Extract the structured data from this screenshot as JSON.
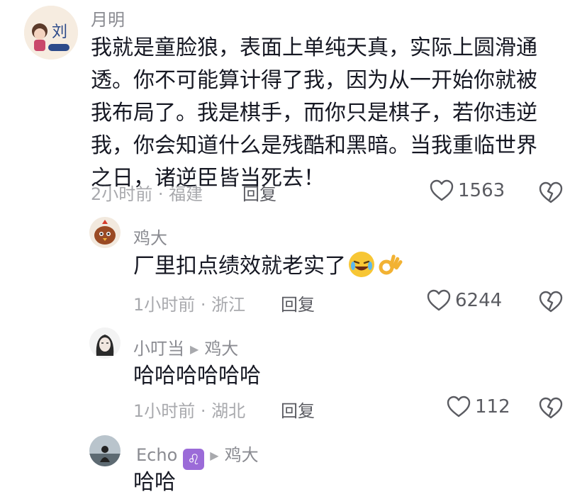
{
  "comments": [
    {
      "name": "月明",
      "text": "我就是童脸狼，表面上单纯天真，实际上圆滑通透。你不可能算计得了我，因为从一开始你就被我布局了。我是棋手，而你只是棋子，若你违逆我，你会知道什么是残酷和黑暗。当我重临世界之日，诸逆臣皆当死去！",
      "meta": "2小时前 · 福建",
      "reply_label": "回复",
      "likes": "1563"
    },
    {
      "name": "鸡大",
      "text": "厂里扣点绩效就老实了",
      "emojis": [
        "laughing-crying-emoji",
        "ok-hand-emoji"
      ],
      "meta": "1小时前 · 浙江",
      "reply_label": "回复",
      "likes": "6244"
    },
    {
      "name": "小叮当",
      "reply_to": "鸡大",
      "text": "哈哈哈哈哈哈",
      "meta": "1小时前 · 湖北",
      "reply_label": "回复",
      "likes": "112"
    },
    {
      "name": "Echo",
      "badge": "♌",
      "reply_to": "鸡大",
      "text": "哈哈"
    }
  ],
  "colors": {
    "name": "#8a8b91",
    "text": "#161823",
    "meta": "#a8a9ad",
    "badge": "#9b6bd8"
  }
}
